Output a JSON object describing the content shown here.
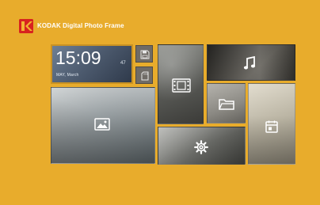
{
  "header": {
    "brand_title": "KODAK Digital Photo Frame",
    "logo_icon": "kodak-logo"
  },
  "clock": {
    "time": "15:09",
    "ampm": "47",
    "date": "MAY, March"
  },
  "tiles": [
    {
      "name": "clock-widget",
      "icon": "none"
    },
    {
      "name": "save-button",
      "icon": "save-icon"
    },
    {
      "name": "sd-card-button",
      "icon": "sd-card-icon"
    },
    {
      "name": "video-tile",
      "icon": "film-icon"
    },
    {
      "name": "music-tile",
      "icon": "music-note-icon"
    },
    {
      "name": "photos-tile",
      "icon": "image-icon"
    },
    {
      "name": "files-tile",
      "icon": "folder-icon"
    },
    {
      "name": "calendar-tile",
      "icon": "calendar-icon"
    },
    {
      "name": "settings-tile",
      "icon": "gear-icon"
    }
  ],
  "colors": {
    "background": "#e8ac2c",
    "brand_red": "#d8231f",
    "text": "#ffffff"
  }
}
